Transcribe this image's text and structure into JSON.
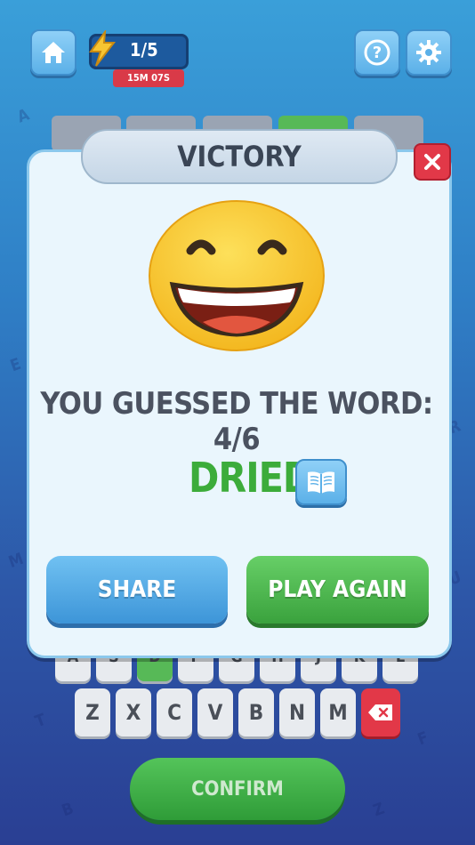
{
  "top_bar": {
    "energy": "1/5",
    "timer": "15M 07S"
  },
  "dialog": {
    "title": "VICTORY",
    "result_text": "YOU GUESSED THE WORD: 4/6",
    "word": "DRIED",
    "share_label": "SHARE",
    "play_again_label": "PLAY AGAIN"
  },
  "keyboard": {
    "peek_row": [
      "A",
      "S",
      "D",
      "F",
      "G",
      "H",
      "J",
      "K",
      "L"
    ],
    "bottom_row": [
      "Z",
      "X",
      "C",
      "V",
      "B",
      "N",
      "M"
    ],
    "confirm_label": "CONFIRM"
  },
  "colors": {
    "accent_blue": "#5bb0e8",
    "correct_green": "#3cac3a",
    "danger_red": "#e23848"
  }
}
